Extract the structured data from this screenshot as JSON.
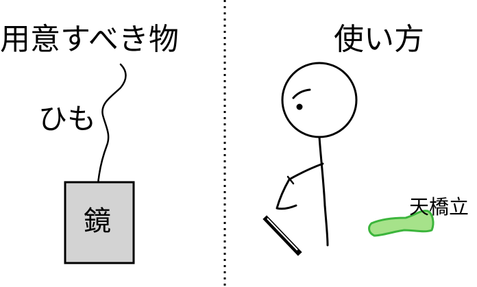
{
  "left_panel": {
    "title": "用意すべき物",
    "string_label": "ひも",
    "mirror_label": "鏡"
  },
  "right_panel": {
    "title": "使い方",
    "place_label": "天橋立"
  },
  "colors": {
    "mirror_fill": "#d3d3d3",
    "ground_fill": "#a6e28a",
    "ground_stroke": "#3cb53c",
    "ink": "#000000"
  }
}
